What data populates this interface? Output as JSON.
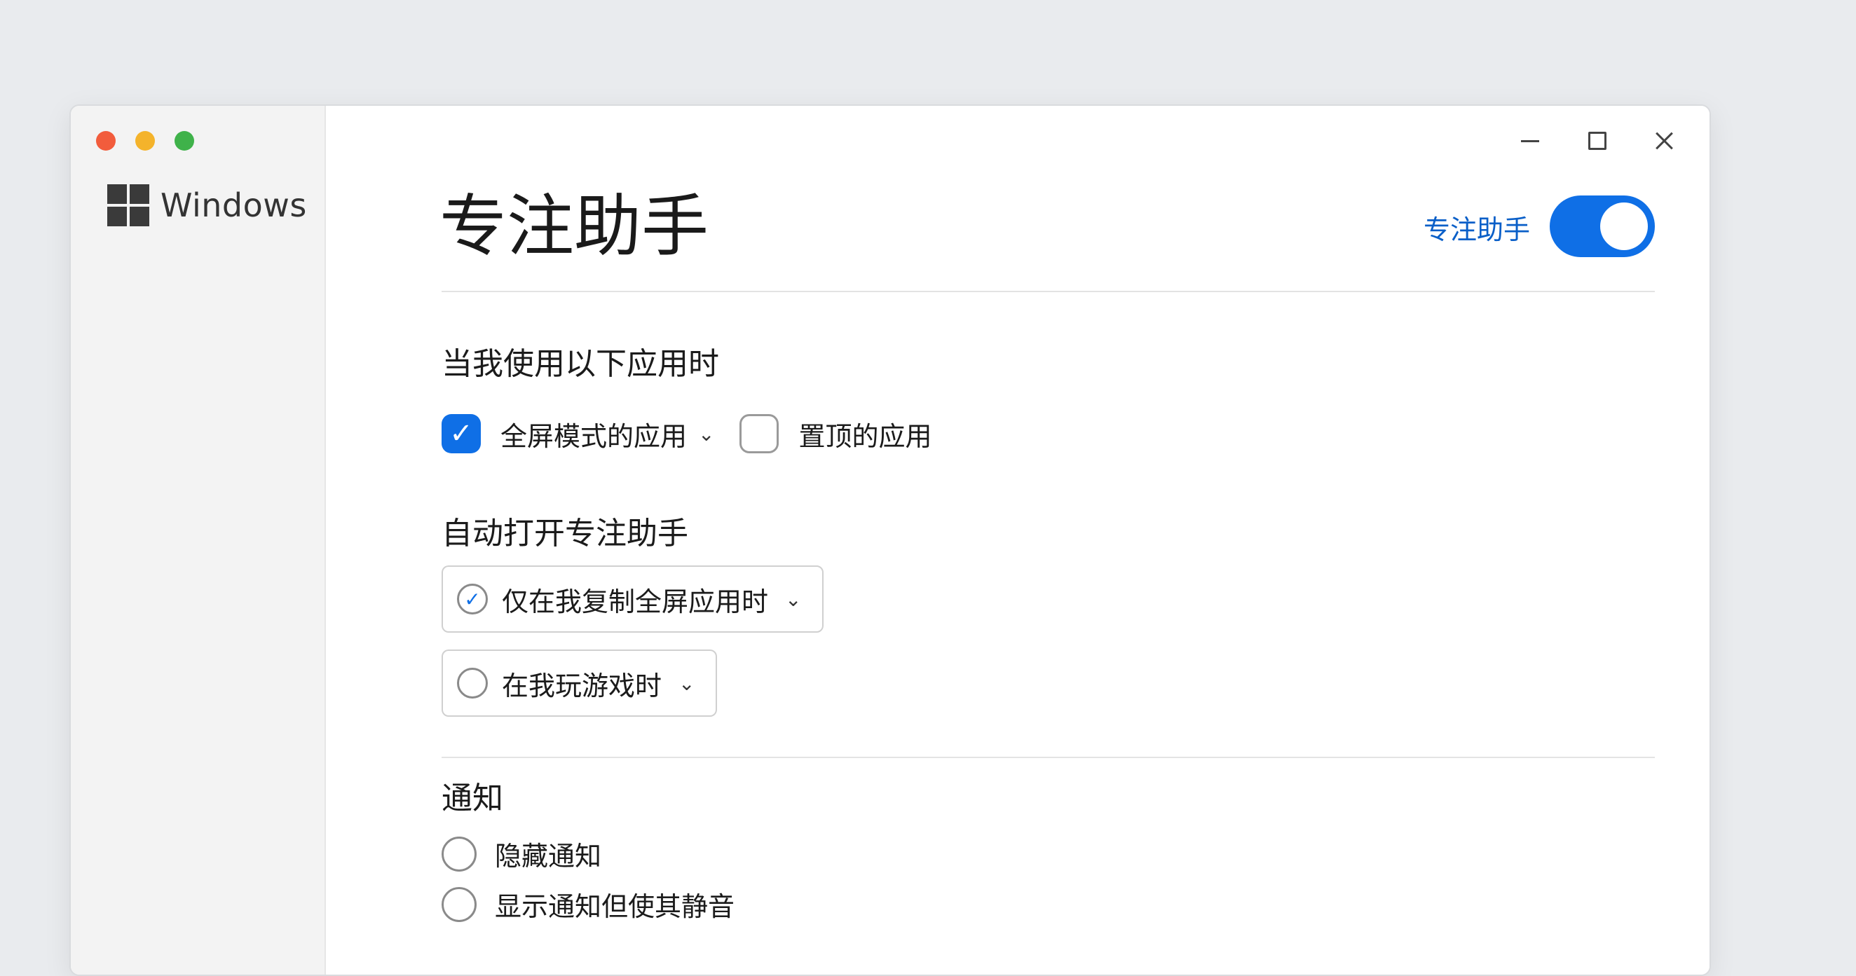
{
  "sidebar": {
    "logo_text": "Windows"
  },
  "header": {
    "title": "专注助手",
    "toggle_label": "专注助手",
    "toggle_on": true
  },
  "section_apps": {
    "heading": "当我使用以下应用时",
    "options": [
      {
        "label": "全屏模式的应用",
        "checked": true,
        "has_chevron": true
      },
      {
        "label": "置顶的应用",
        "checked": false,
        "has_chevron": false
      }
    ]
  },
  "section_auto": {
    "heading": "自动打开专注助手",
    "dropdowns": [
      {
        "label": "仅在我复制全屏应用时",
        "checked": true
      },
      {
        "label": "在我玩游戏时",
        "checked": false
      }
    ]
  },
  "section_notify": {
    "heading": "通知",
    "radios": [
      {
        "label": "隐藏通知",
        "selected": false
      },
      {
        "label": "显示通知但使其静音",
        "selected": false
      }
    ]
  },
  "colors": {
    "accent": "#0f6fe6",
    "link": "#0a5fc8"
  },
  "icons": {
    "check": "✓",
    "chevron": "⌄"
  }
}
